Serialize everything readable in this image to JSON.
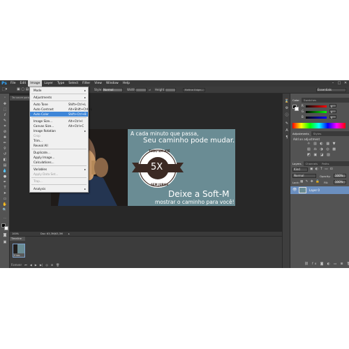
{
  "menubar": {
    "logo": "Ps",
    "items": [
      "File",
      "Edit",
      "Image",
      "Layer",
      "Type",
      "Select",
      "Filter",
      "View",
      "Window",
      "Help"
    ],
    "minimize": "–",
    "maximize": "□",
    "close": "✕"
  },
  "options": {
    "style_label": "Style:",
    "style_value": "Normal",
    "width_label": "Width:",
    "height_label": "Height:",
    "refine_edge": "Refine Edge...",
    "workspace": "Essentials"
  },
  "document": {
    "tab_title": "Tar azure para",
    "zoom": "100%",
    "doc_info": "Doc: 63,3M/63,3M"
  },
  "image_menu": {
    "items": [
      {
        "label": "Mode",
        "submenu": true
      },
      {
        "label": "Adjustments",
        "submenu": true
      },
      {
        "label": "Auto Tone",
        "shortcut": "Shift+Ctrl+L"
      },
      {
        "label": "Auto Contrast",
        "shortcut": "Alt+Shift+Ctrl+L"
      },
      {
        "label": "Auto Color",
        "shortcut": "Shift+Ctrl+B",
        "highlighted": true
      },
      {
        "label": "Image Size...",
        "shortcut": "Alt+Ctrl+I"
      },
      {
        "label": "Canvas Size...",
        "shortcut": "Alt+Ctrl+C"
      },
      {
        "label": "Image Rotation",
        "submenu": true
      },
      {
        "label": "Crop",
        "disabled": true
      },
      {
        "label": "Trim..."
      },
      {
        "label": "Reveal All"
      },
      {
        "label": "Duplicate..."
      },
      {
        "label": "Apply Image..."
      },
      {
        "label": "Calculations..."
      },
      {
        "label": "Variables",
        "submenu": true
      },
      {
        "label": "Apply Data Set...",
        "disabled": true
      },
      {
        "label": "Trap...",
        "disabled": true
      },
      {
        "label": "Analysis",
        "submenu": true
      }
    ]
  },
  "ad": {
    "line1": "A cada minuto que passa,",
    "line2": "Seu caminho pode mudar.",
    "badge_top": "TUDO EM ATÉ",
    "badge_main": "5X",
    "badge_bottom": "SEM JUROS",
    "headline": "Deixe a Soft-M",
    "tagline": "mostrar o caminho para você!"
  },
  "color_panel": {
    "tabs": [
      "Color",
      "Swatches"
    ],
    "channels": [
      "R",
      "G",
      "B"
    ],
    "values": [
      "0",
      "0",
      "0"
    ]
  },
  "adjustments_panel": {
    "tabs": [
      "Adjustments",
      "Styles"
    ],
    "title": "Add an adjustment"
  },
  "layers_panel": {
    "tabs": [
      "Layers",
      "Channels",
      "Paths"
    ],
    "kind_filter": "Kind",
    "blend_mode": "Normal",
    "opacity_label": "Opacity:",
    "opacity_value": "100%",
    "lock_label": "Lock:",
    "fill_label": "Fill:",
    "fill_value": "100%",
    "layers": [
      {
        "name": "Layer 0"
      }
    ]
  },
  "timeline": {
    "tab_label": "Timeline",
    "frame_delay": "0 sec.",
    "loop_value": "Forever"
  },
  "colors": {
    "accent": "#3e86d8",
    "ad_bg": "#6a8c94",
    "badge_dark": "#3b2a24"
  }
}
